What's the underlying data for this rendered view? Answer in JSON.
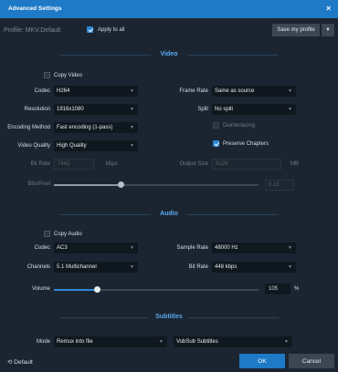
{
  "window": {
    "title": "Advanced Settings",
    "close_glyph": "×"
  },
  "header": {
    "profile_label": "Profile: MKV.Default",
    "apply_to_all_label": "Apply to all",
    "apply_to_all_checked": true,
    "save_profile_label": "Save my profile",
    "save_profile_arrow": "▼"
  },
  "video": {
    "section_title": "Video",
    "copy_video_label": "Copy Video",
    "copy_video_checked": false,
    "codec_label": "Codec",
    "codec_value": "H264",
    "resolution_label": "Resolution",
    "resolution_value": "1916x1080",
    "encoding_method_label": "Encoding Method",
    "encoding_method_value": "Fast encoding (1-pass)",
    "video_quality_label": "Video Quality",
    "video_quality_value": "High Quality",
    "frame_rate_label": "Frame Rate",
    "frame_rate_value": "Same as source",
    "split_label": "Split",
    "split_value": "No split",
    "deinterlacing_label": "Deinterlacing",
    "deinterlacing_checked": false,
    "preserve_chapters_label": "Preserve Chapters",
    "preserve_chapters_checked": true,
    "bit_rate_label": "Bit Rate",
    "bit_rate_value": "7442",
    "bit_rate_unit": "kbps",
    "output_size_label": "Output Size",
    "output_size_value": "9129",
    "output_size_unit": "MB",
    "bits_pixel_label": "Bits/Pixel",
    "bits_pixel_value": "0.15",
    "bits_pixel_level": 0.33
  },
  "audio": {
    "section_title": "Audio",
    "copy_audio_label": "Copy Audio",
    "copy_audio_checked": false,
    "codec_label": "Codec",
    "codec_value": "AC3",
    "channels_label": "Channels",
    "channels_value": "5.1 Multichannel",
    "sample_rate_label": "Sample Rate",
    "sample_rate_value": "48000 Hz",
    "bit_rate_label": "Bit Rate",
    "bit_rate_value": "448 kbps",
    "volume_label": "Volume",
    "volume_value": "105",
    "volume_unit": "%",
    "volume_level": 0.21
  },
  "subtitles": {
    "section_title": "Subtitles",
    "mode_label": "Mode",
    "mode_value": "Remux into file",
    "track_value": "VobSub Subtitles"
  },
  "footer": {
    "default_label": "Default",
    "ok_label": "OK",
    "cancel_label": "Cancel"
  },
  "colors": {
    "title_bar": "#1e79c6",
    "background": "#1b2531",
    "section_title": "#5aaaf0",
    "accent": "#2f89d8"
  },
  "icons": {
    "dropdown": "chevron-down-icon",
    "default": "reset-icon",
    "close": "close-icon"
  }
}
